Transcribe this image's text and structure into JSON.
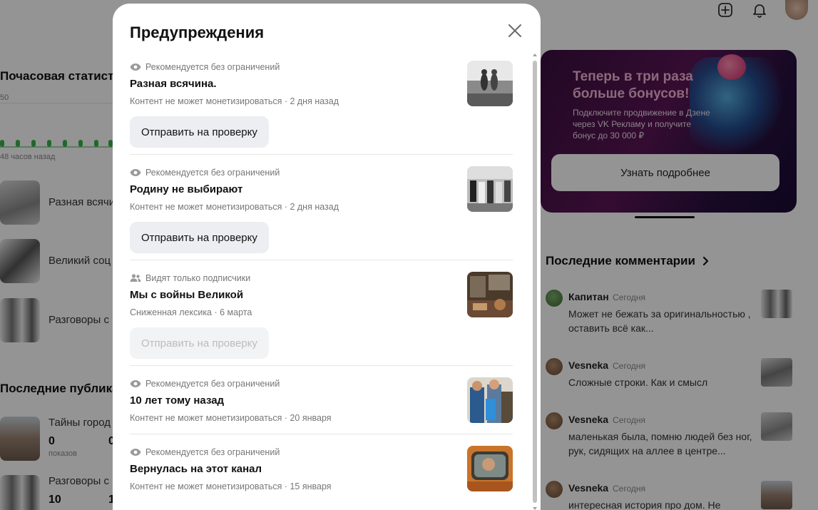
{
  "background": {
    "left": {
      "stats_title": "Почасовая статистика",
      "scale_label": "50",
      "time_ago": "48 часов назад",
      "rows": [
        {
          "label": "Разная всячина."
        },
        {
          "label": "Великий соц"
        },
        {
          "label": "Разговоры с"
        }
      ],
      "publications_title": "Последние публикации",
      "publications": [
        {
          "title": "Тайны город",
          "count": "0",
          "count2": "0",
          "caption": "показов"
        },
        {
          "title": "Разговоры с",
          "count": "10",
          "count2": "1",
          "caption": ""
        }
      ]
    },
    "promo": {
      "title": "Теперь в три раза больше бонусов!",
      "text": "Подключите продвижение в Дзене через VK Рекламу и получите бонус до 30 000 ₽",
      "button": "Узнать подробнее"
    },
    "comments": {
      "title": "Последние комментарии",
      "items": [
        {
          "author": "Капитан",
          "date": "Сегодня",
          "text": "Может не бежать за оригинальностью , оставить всё как..."
        },
        {
          "author": "Vesneka",
          "date": "Сегодня",
          "text": "Сложные строки. Как и смысл"
        },
        {
          "author": "Vesneka",
          "date": "Сегодня",
          "text": "маленькая была, помню людей без ног, рук, сидящих на аллее в центре..."
        },
        {
          "author": "Vesneka",
          "date": "Сегодня",
          "text": "интересная история про дом. Не"
        }
      ]
    }
  },
  "modal": {
    "title": "Предупреждения",
    "items": [
      {
        "status_icon": "eye-icon",
        "status": "Рекомендуется без ограничений",
        "title": "Разная всячина.",
        "meta": "Контент не может монетизироваться · 2 дня назад",
        "button": "Отправить на проверку",
        "button_disabled": false
      },
      {
        "status_icon": "eye-icon",
        "status": "Рекомендуется без ограничений",
        "title": "Родину не выбирают",
        "meta": "Контент не может монетизироваться · 2 дня назад",
        "button": "Отправить на проверку",
        "button_disabled": false
      },
      {
        "status_icon": "subscribers-icon",
        "status": "Видят только подписчики",
        "title": "Мы с войны Великой",
        "meta": "Сниженная лексика · 6 марта",
        "button": "Отправить на проверку",
        "button_disabled": true
      },
      {
        "status_icon": "eye-icon",
        "status": "Рекомендуется без ограничений",
        "title": "10 лет тому назад",
        "meta": "Контент не может монетизироваться · 20 января"
      },
      {
        "status_icon": "eye-icon",
        "status": "Рекомендуется без ограничений",
        "title": "Вернулась на этот канал",
        "meta": "Контент не может монетизироваться · 15 января"
      }
    ]
  },
  "colors": {
    "overlay": "#000000",
    "button_bg": "#eceef1",
    "accent_green": "#3cb24a",
    "promo_bg": "#4a1350"
  }
}
